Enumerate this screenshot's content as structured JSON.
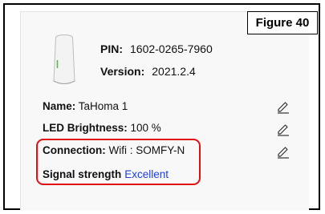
{
  "figure_label": "Figure 40",
  "device": {
    "pin_label": "PIN:",
    "pin_value": "1602-0265-7960",
    "version_label": "Version:",
    "version_value": "2021.2.4"
  },
  "details": {
    "name_label": "Name:",
    "name_value": "TaHoma 1",
    "led_label": "LED Brightness:",
    "led_value": "100 %",
    "connection_label": "Connection:",
    "connection_value": "Wifi : SOMFY-N",
    "signal_label": "Signal strength",
    "signal_value": "Excellent"
  },
  "colors": {
    "highlight": "#e01010",
    "signal_value": "#1f3fd6",
    "device_led": "#3cc83c"
  },
  "icons": {
    "device": "tahoma-box-icon",
    "edit": "pencil-icon"
  }
}
